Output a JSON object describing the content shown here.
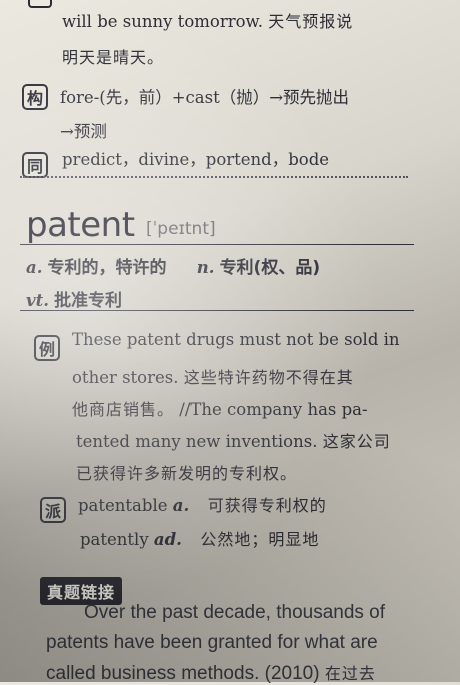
{
  "top": {
    "line1_en": "will be sunny tomorrow.",
    "line1_zh": "天气预报说",
    "line2_zh": "明天是晴天。"
  },
  "gou": {
    "icon": "构",
    "line1": "fore-(先，前）+cast（抛）→预先抛出",
    "line2": "→预测"
  },
  "tong": {
    "icon": "同",
    "text": "predict，divine，portend，bode"
  },
  "entry": {
    "headword": "patent",
    "phonetic": "[ˈpeɪtnt]",
    "sense_a_pos": "a.",
    "sense_a": "专利的，特许的",
    "sense_n_pos": "n.",
    "sense_n": "专利(权、品)",
    "sense_vt_pos": "vt.",
    "sense_vt": "批准专利"
  },
  "li": {
    "icon": "例",
    "line1": "These patent drugs must not be sold in",
    "line2_en": "other stores.",
    "line2_zh": "这些特许药物不得在其",
    "line3_zh": "他商店销售。",
    "line3_en": "//The company has pa-",
    "line4_en": "tented many new inventions.",
    "line4_zh": "这家公司",
    "line5_zh": "已获得许多新发明的专利权。"
  },
  "pai": {
    "icon": "派",
    "line1_en": "patentable",
    "line1_pos": "a.",
    "line1_zh": "可获得专利权的",
    "line2_en": "patently",
    "line2_pos": "ad.",
    "line2_zh": "公然地；明显地"
  },
  "zhenti": {
    "badge": "真题链接",
    "line1": "Over the past decade, thousands of",
    "line2": "patents have been granted for what are",
    "line3_en": "called business methods. (2010)",
    "line3_zh": "在过去"
  }
}
